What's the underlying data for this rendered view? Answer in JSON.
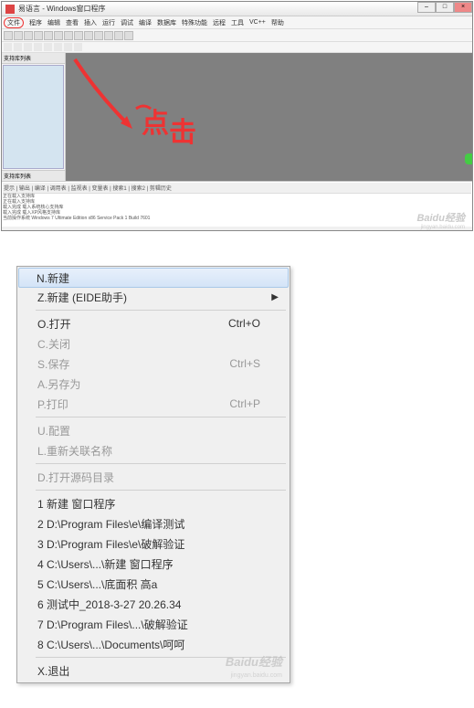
{
  "window": {
    "title": "易语言 - Windows窗口程序",
    "menus": [
      "程序",
      "编辑",
      "查看",
      "插入",
      "运行",
      "调试",
      "编译",
      "数据库",
      "特殊功能",
      "远程",
      "工具",
      "VC++",
      "帮助"
    ],
    "file_menu_label": "文件",
    "sidebar_tab": "支持库列表",
    "sidebar_bottom": "支持库列表",
    "bottom_tabs": "提示 | 输出 | 编译 | 调用表 | 监视表 | 变量表 | 搜索1 | 搜索2 | 剪辑历史",
    "log": [
      "正在载入支持库",
      "正在载入支持库",
      "载入完成 载入系统核心支持库",
      "载入完成 载入XP风格支持库",
      "当前操作系统 Windows 7 Ultimate Edition x86 Service Pack 1 Build 7601"
    ],
    "annotation_text": "点击"
  },
  "watermark": {
    "brand": "Baidu经验",
    "url": "jingyan.baidu.com"
  },
  "context_menu": {
    "items": [
      {
        "label": "N.新建",
        "type": "item",
        "selected": true
      },
      {
        "label": "Z.新建 (EIDE助手)",
        "type": "submenu"
      },
      {
        "type": "sep"
      },
      {
        "label": "O.打开",
        "shortcut": "Ctrl+O",
        "type": "item"
      },
      {
        "label": "C.关闭",
        "type": "item",
        "disabled": true
      },
      {
        "label": "S.保存",
        "shortcut": "Ctrl+S",
        "type": "item",
        "disabled": true
      },
      {
        "label": "A.另存为",
        "type": "item",
        "disabled": true
      },
      {
        "label": "P.打印",
        "shortcut": "Ctrl+P",
        "type": "item",
        "disabled": true
      },
      {
        "type": "sep"
      },
      {
        "label": "U.配置",
        "type": "item",
        "disabled": true
      },
      {
        "label": "L.重新关联名称",
        "type": "item",
        "disabled": true
      },
      {
        "type": "sep"
      },
      {
        "label": "D.打开源码目录",
        "type": "item",
        "disabled": true
      },
      {
        "type": "sep"
      },
      {
        "label": "1 新建 窗口程序",
        "type": "item"
      },
      {
        "label": "2 D:\\Program Files\\e\\编译测试",
        "type": "item"
      },
      {
        "label": "3 D:\\Program Files\\e\\破解验证",
        "type": "item"
      },
      {
        "label": "4 C:\\Users\\...\\新建 窗口程序",
        "type": "item"
      },
      {
        "label": "5 C:\\Users\\...\\底面积 高a",
        "type": "item"
      },
      {
        "label": "6 测试中_2018-3-27 20.26.34",
        "type": "item"
      },
      {
        "label": "7 D:\\Program Files\\...\\破解验证",
        "type": "item"
      },
      {
        "label": "8 C:\\Users\\...\\Documents\\呵呵",
        "type": "item"
      },
      {
        "type": "sep"
      },
      {
        "label": "X.退出",
        "type": "item"
      }
    ]
  }
}
